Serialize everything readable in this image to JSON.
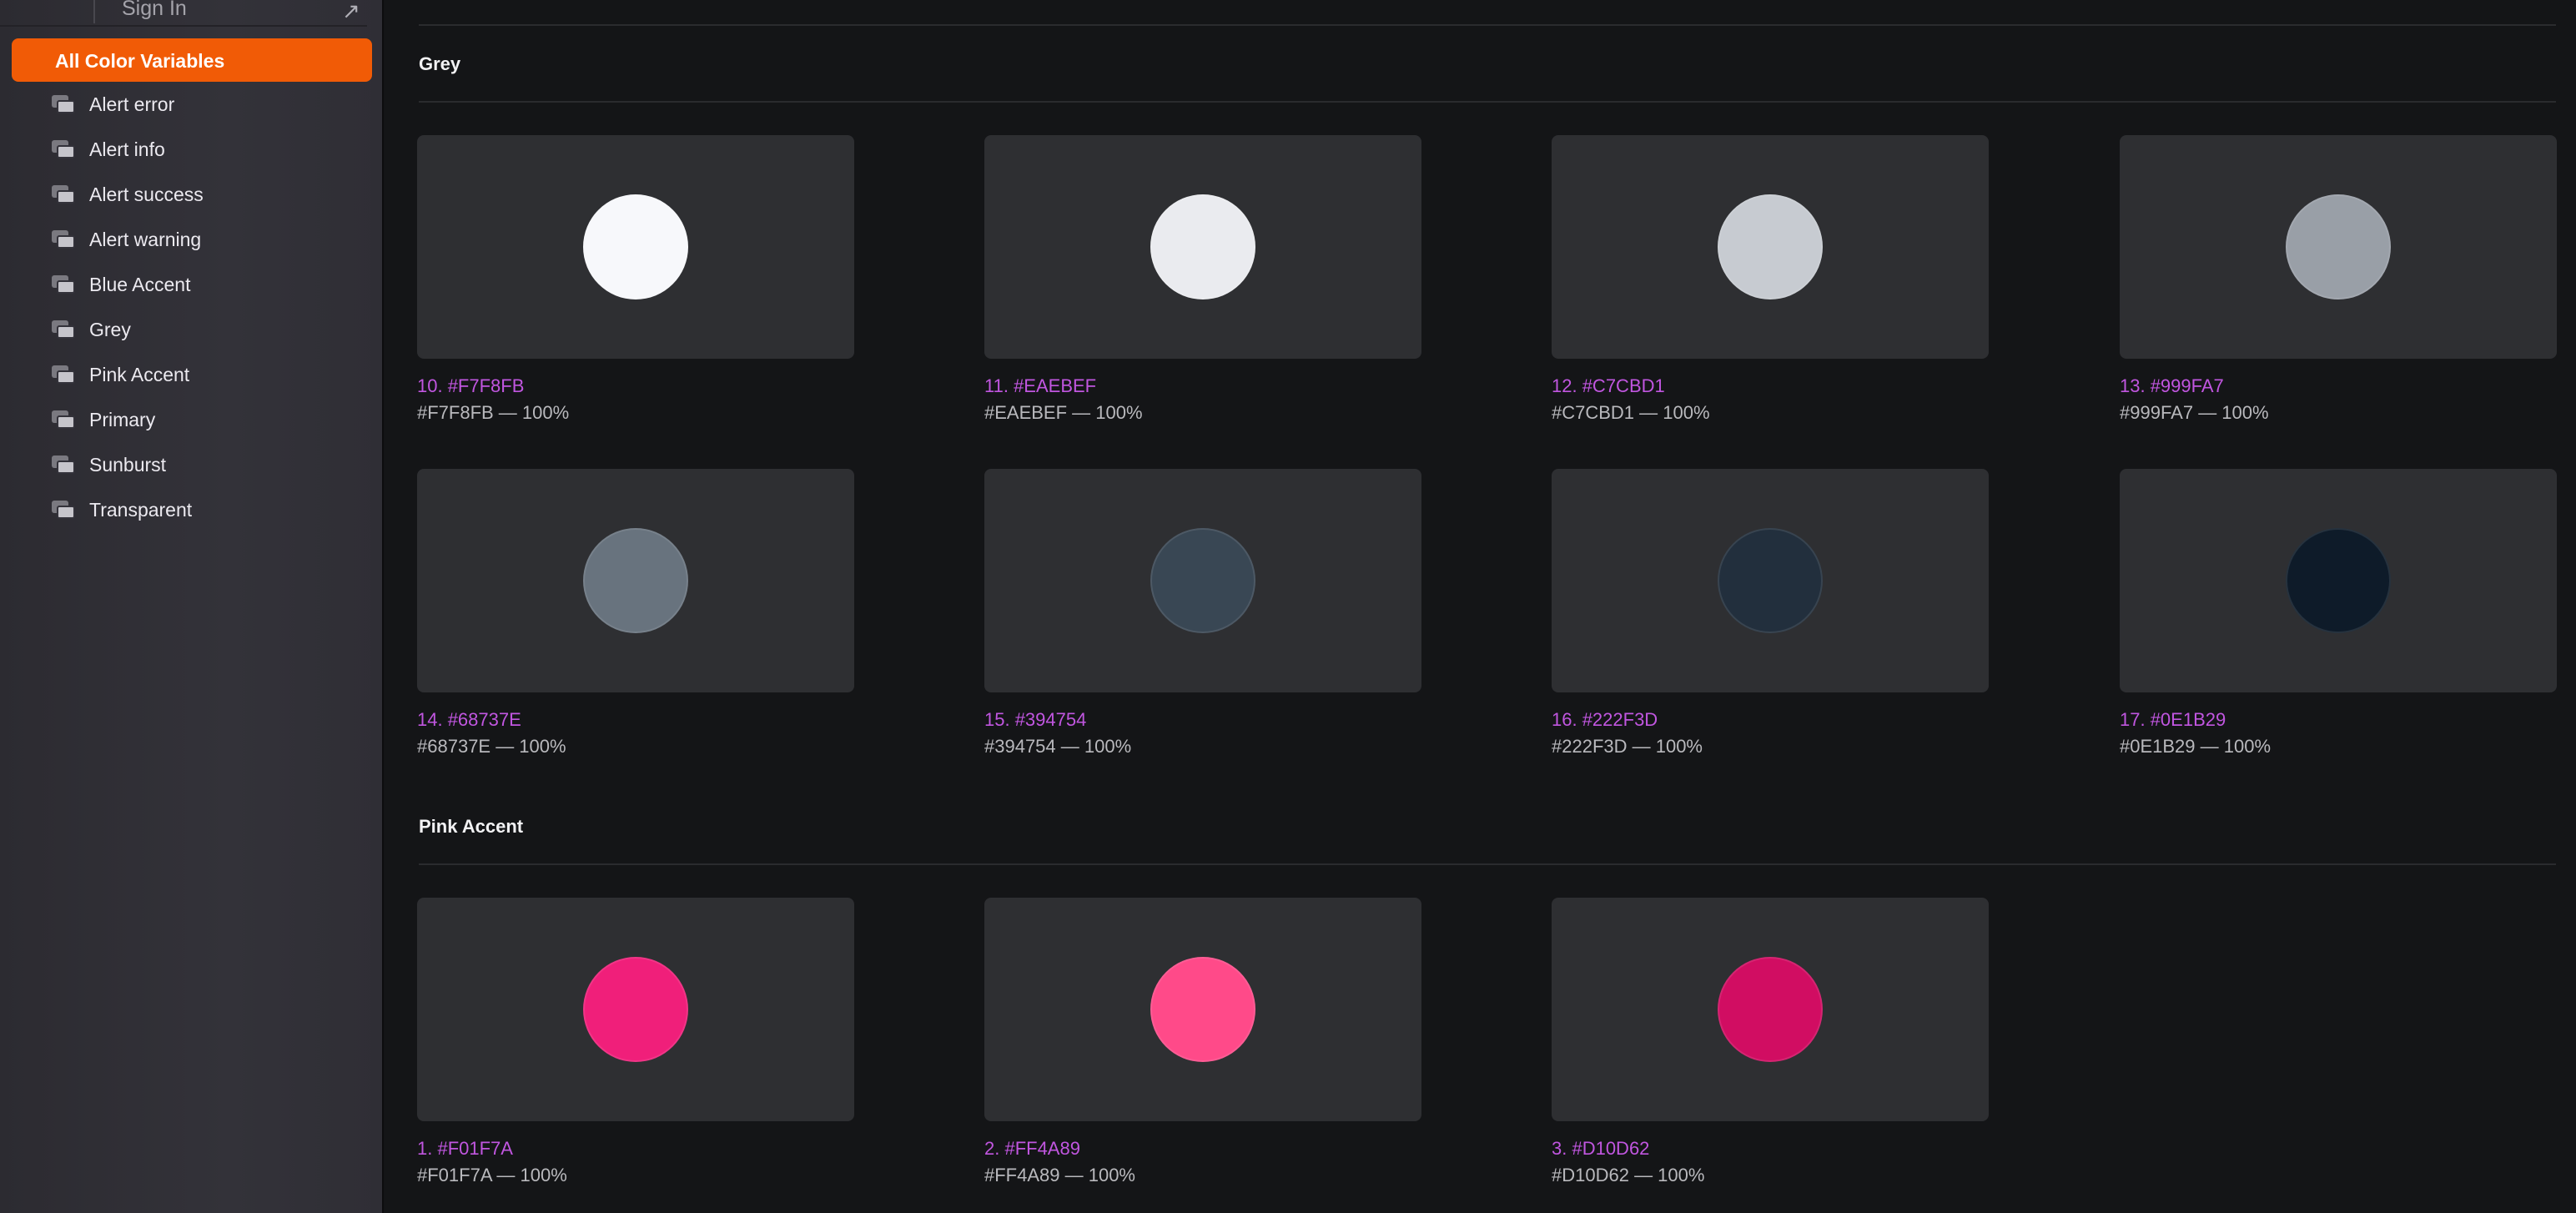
{
  "sidebar": {
    "sign_in_label": "Sign In",
    "sign_in_arrow": "↗",
    "active_item": "All Color Variables",
    "items": [
      {
        "label": "Alert error"
      },
      {
        "label": "Alert info"
      },
      {
        "label": "Alert success"
      },
      {
        "label": "Alert warning"
      },
      {
        "label": "Blue Accent"
      },
      {
        "label": "Grey"
      },
      {
        "label": "Pink Accent"
      },
      {
        "label": "Primary"
      },
      {
        "label": "Sunburst"
      },
      {
        "label": "Transparent"
      }
    ]
  },
  "sections": [
    {
      "title": "Grey",
      "swatches": [
        {
          "name": "10. #F7F8FB",
          "value": "#F7F8FB — 100%",
          "color": "#F7F8FB"
        },
        {
          "name": "11. #EAEBEF",
          "value": "#EAEBEF — 100%",
          "color": "#EAEBEF"
        },
        {
          "name": "12. #C7CBD1",
          "value": "#C7CBD1 — 100%",
          "color": "#C7CBD1"
        },
        {
          "name": "13. #999FA7",
          "value": "#999FA7 — 100%",
          "color": "#999FA7"
        },
        {
          "name": "14. #68737E",
          "value": "#68737E — 100%",
          "color": "#68737E"
        },
        {
          "name": "15. #394754",
          "value": "#394754 — 100%",
          "color": "#394754"
        },
        {
          "name": "16. #222F3D",
          "value": "#222F3D — 100%",
          "color": "#222F3D"
        },
        {
          "name": "17. #0E1B29",
          "value": "#0E1B29 — 100%",
          "color": "#0E1B29"
        }
      ]
    },
    {
      "title": "Pink Accent",
      "swatches": [
        {
          "name": "1. #F01F7A",
          "value": "#F01F7A — 100%",
          "color": "#F01F7A"
        },
        {
          "name": "2. #FF4A89",
          "value": "#FF4A89 — 100%",
          "color": "#FF4A89"
        },
        {
          "name": "3. #D10D62",
          "value": "#D10D62 — 100%",
          "color": "#D10D62"
        }
      ]
    }
  ],
  "colors": {
    "accent": "#F15B06",
    "swatch_name": "#C156E0"
  }
}
